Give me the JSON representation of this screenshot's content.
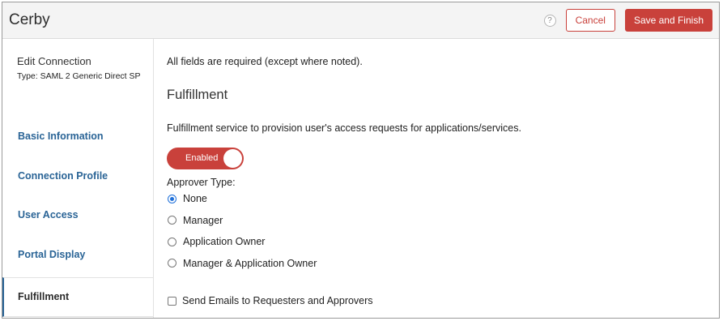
{
  "header": {
    "title": "Cerby",
    "help_icon": "?",
    "cancel_label": "Cancel",
    "save_label": "Save and Finish"
  },
  "sidebar": {
    "title": "Edit Connection",
    "type": "Type: SAML 2 Generic Direct SP",
    "items": [
      {
        "label": "Basic Information"
      },
      {
        "label": "Connection Profile"
      },
      {
        "label": "User Access"
      },
      {
        "label": "Portal Display"
      },
      {
        "label": "Fulfillment",
        "active": true
      }
    ]
  },
  "main": {
    "note": "All fields are required (except where noted).",
    "section_title": "Fulfillment",
    "description": "Fulfillment service to provision user's access requests for applications/services.",
    "toggle": {
      "label": "Enabled",
      "on": true
    },
    "approver_label": "Approver Type:",
    "approver_options": [
      {
        "label": "None",
        "selected": true
      },
      {
        "label": "Manager",
        "selected": false
      },
      {
        "label": "Application Owner",
        "selected": false
      },
      {
        "label": "Manager & Application Owner",
        "selected": false
      }
    ],
    "send_emails_label": "Send Emails to Requesters and Approvers",
    "send_emails_checked": false
  },
  "colors": {
    "accent": "#c9413b",
    "link": "#2a6496",
    "radio_selected": "#1e6fd9"
  }
}
